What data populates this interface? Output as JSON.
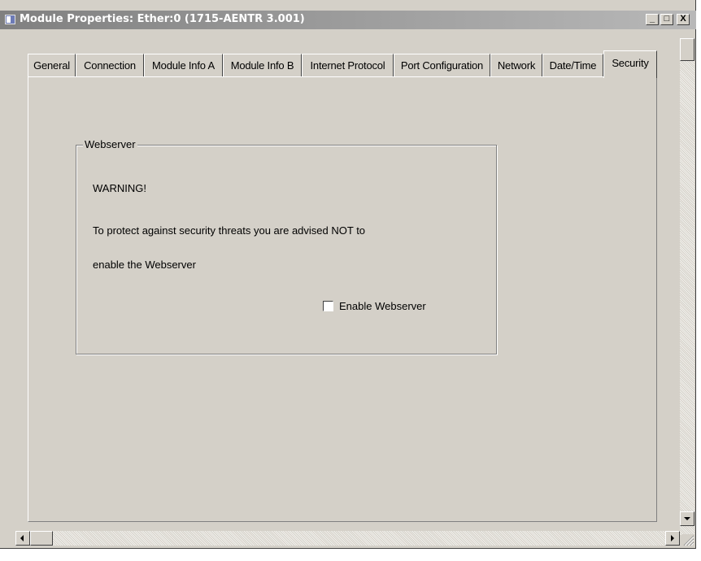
{
  "window": {
    "title": "Module Properties: Ether:0 (1715-AENTR 3.001)",
    "controls": {
      "minimize_label": "_",
      "maximize_label": "□",
      "close_label": "X"
    }
  },
  "tabs": [
    {
      "label": "General"
    },
    {
      "label": "Connection"
    },
    {
      "label": "Module Info A"
    },
    {
      "label": "Module Info B"
    },
    {
      "label": "Internet Protocol"
    },
    {
      "label": "Port Configuration"
    },
    {
      "label": "Network"
    },
    {
      "label": "Date/Time"
    },
    {
      "label": "Security",
      "active": true
    }
  ],
  "webserver": {
    "group_label": "Webserver",
    "warning_title": "WARNING!",
    "warning_line1": "To protect against security threats you are advised NOT to",
    "warning_line2": "enable the Webserver",
    "enable_label": "Enable Webserver",
    "enable_checked": false
  },
  "colors": {
    "face": "#d4d0c8",
    "titlebar_inactive": "#808080"
  }
}
